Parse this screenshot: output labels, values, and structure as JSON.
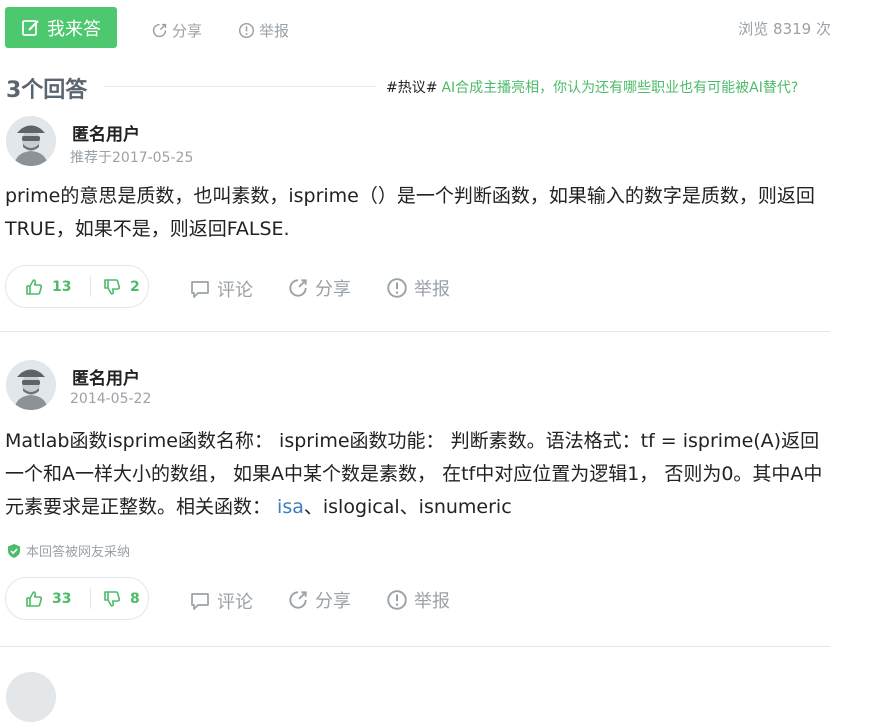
{
  "header": {
    "answer_button": "我来答",
    "share": "分享",
    "report": "举报",
    "views": "浏览 8319 次"
  },
  "answers_count": "3个回答",
  "hot_topic": {
    "tag": "#热议#",
    "text": "AI合成主播亮相，你认为还有哪些职业也有可能被AI替代?"
  },
  "answers": [
    {
      "user": "匿名用户",
      "date": "推荐于2017-05-25",
      "content": "prime的意思是质数，也叫素数，isprime（）是一个判断函数，如果输入的数字是质数，则返回TRUE，如果不是，则返回FALSE.",
      "likes": "13",
      "dislikes": "2",
      "comment": "评论",
      "share": "分享",
      "report": "举报"
    },
    {
      "user": "匿名用户",
      "date": "2014-05-22",
      "content_pre": "Matlab函数isprime函数名称： isprime函数功能： 判断素数。语法格式：tf = isprime(A)返回一个和A一样大小的数组， 如果A中某个数是素数， 在tf中对应位置为逻辑1， 否则为0。其中A中元素要求是正整数。相关函数： ",
      "content_link": "isa",
      "content_post": "、islogical、isnumeric",
      "adopted": "本回答被网友采纳",
      "likes": "33",
      "dislikes": "8",
      "comment": "评论",
      "share": "分享",
      "report": "举报"
    }
  ]
}
